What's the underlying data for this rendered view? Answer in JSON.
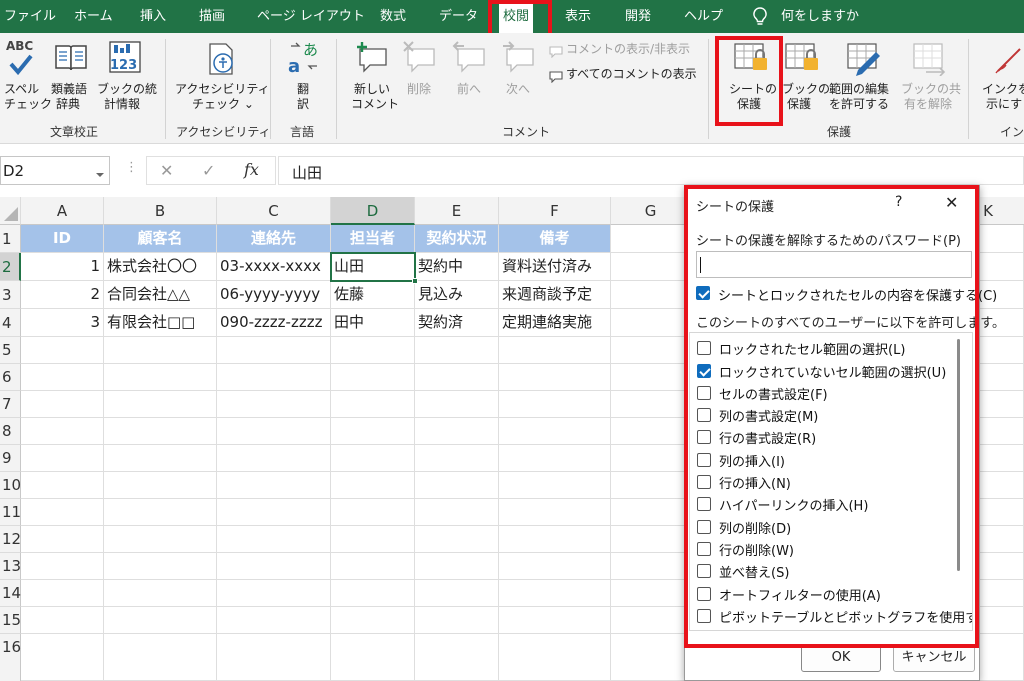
{
  "tabs": [
    "ファイル",
    "ホーム",
    "挿入",
    "描画",
    "ページ レイアウト",
    "数式",
    "データ",
    "校閲",
    "表示",
    "開発",
    "ヘルプ",
    "何をしますか"
  ],
  "ribbon": {
    "spell": [
      "スペル",
      "チェック"
    ],
    "thesaurus": [
      "類義語",
      "辞典"
    ],
    "stats": [
      "ブックの統",
      "計情報"
    ],
    "abc": "ABC",
    "num123": "123",
    "grp_proof": "文章校正",
    "access": [
      "アクセシビリティ",
      "チェック ⌄"
    ],
    "grp_access": "アクセシビリティ",
    "translate": [
      "翻",
      "訳"
    ],
    "grp_lang": "言語",
    "newcomment": [
      "新しい",
      "コメント"
    ],
    "delete": "削除",
    "prev": "前へ",
    "next": "次へ",
    "showhide": "コメントの表示/非表示",
    "showall": "すべてのコメントの表示",
    "grp_comment": "コメント",
    "protsheet": [
      "シートの",
      "保護"
    ],
    "protbook": [
      "ブックの",
      "保護"
    ],
    "allowedit": [
      "範囲の編集",
      "を許可する"
    ],
    "unshare": [
      "ブックの共",
      "有を解除"
    ],
    "grp_protect": "保護",
    "ink": [
      "インクを",
      "示にす"
    ],
    "grp_ink": "イン"
  },
  "formula": {
    "namebox": "D2",
    "cancel": "✕",
    "enter": "✓",
    "fx": "fx",
    "value": "山田"
  },
  "columns": [
    "A",
    "B",
    "C",
    "D",
    "E",
    "F",
    "G",
    "K"
  ],
  "rows": [
    "1",
    "2",
    "3",
    "4",
    "5",
    "6",
    "7",
    "8",
    "9",
    "10",
    "11",
    "12",
    "13",
    "14",
    "15",
    "16"
  ],
  "table": {
    "headers": [
      "ID",
      "顧客名",
      "連絡先",
      "担当者",
      "契約状況",
      "備考"
    ],
    "rows": [
      [
        "1",
        "株式会社〇〇",
        "03-xxxx-xxxx",
        "山田",
        "契約中",
        "資料送付済み"
      ],
      [
        "2",
        "合同会社△△",
        "06-yyyy-yyyy",
        "佐藤",
        "見込み",
        "来週商談予定"
      ],
      [
        "3",
        "有限会社□□",
        "090-zzzz-zzzz",
        "田中",
        "契約済",
        "定期連絡実施"
      ]
    ]
  },
  "dialog": {
    "title": "シートの保護",
    "help": "?",
    "close": "✕",
    "pwlabel": "シートの保護を解除するためのパスワード(P)",
    "protect": "シートとロックされたセルの内容を保護する(C)",
    "allowlabel": "このシートのすべてのユーザーに以下を許可します。",
    "options": [
      {
        "label": "ロックされたセル範囲の選択(L)",
        "checked": false
      },
      {
        "label": "ロックされていないセル範囲の選択(U)",
        "checked": true
      },
      {
        "label": "セルの書式設定(F)",
        "checked": false
      },
      {
        "label": "列の書式設定(M)",
        "checked": false
      },
      {
        "label": "行の書式設定(R)",
        "checked": false
      },
      {
        "label": "列の挿入(I)",
        "checked": false
      },
      {
        "label": "行の挿入(N)",
        "checked": false
      },
      {
        "label": "ハイパーリンクの挿入(H)",
        "checked": false
      },
      {
        "label": "列の削除(D)",
        "checked": false
      },
      {
        "label": "行の削除(W)",
        "checked": false
      },
      {
        "label": "並べ替え(S)",
        "checked": false
      },
      {
        "label": "オートフィルターの使用(A)",
        "checked": false
      },
      {
        "label": "ピボットテーブルとピボットグラフを使用する",
        "checked": false
      }
    ],
    "ok": "OK",
    "cancel": "キャンセル"
  },
  "colors": {
    "accent": "#217346",
    "highlight": "#e8121a",
    "header_fill": "#a4c2e9",
    "check": "#0f6cbd"
  }
}
